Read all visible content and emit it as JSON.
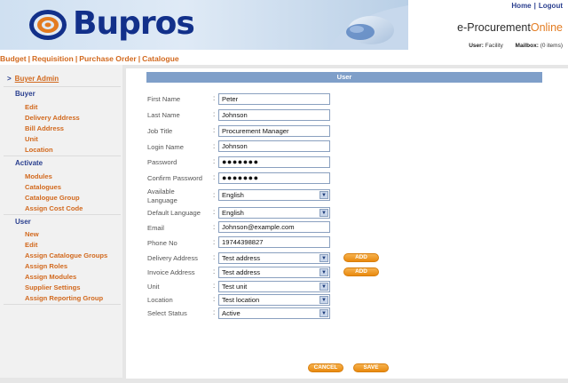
{
  "header": {
    "logo_text": "Bupros",
    "top_links": [
      "Home",
      "Logout"
    ],
    "brand": "e-Procurement",
    "brand_suffix": "Online",
    "user_label": "User:",
    "user_value": "Facility",
    "mailbox_label": "Mailbox:",
    "mailbox_value": "(0 items)"
  },
  "mainnav": [
    "Budget",
    "Requisition",
    "Purchase Order",
    "Catalogue"
  ],
  "sidebar": {
    "admin_link": "Buyer Admin",
    "sections": [
      {
        "heading": "Buyer",
        "items": [
          "Edit",
          "Delivery Address",
          "Bill Address",
          "Unit",
          "Location"
        ]
      },
      {
        "heading": "Activate",
        "items": [
          "Modules",
          "Catalogues",
          "Catalogue Group",
          "Assign Cost Code"
        ]
      },
      {
        "heading": "User",
        "items": [
          "New",
          "Edit",
          "Assign Catalogue Groups",
          "Assign Roles",
          "Assign Modules",
          "Supplier Settings",
          "Assign Reporting Group"
        ]
      }
    ]
  },
  "form": {
    "title": "User",
    "colon": ":",
    "fields": {
      "first_name": {
        "label": "First Name",
        "value": "Peter"
      },
      "last_name": {
        "label": "Last Name",
        "value": "Johnson"
      },
      "job_title": {
        "label": "Job Title",
        "value": "Procurement Manager"
      },
      "login_name": {
        "label": "Login Name",
        "value": "Johnson"
      },
      "password": {
        "label": "Password",
        "value": "●●●●●●●"
      },
      "confirm_password": {
        "label": "Confirm Password",
        "value": "●●●●●●●"
      },
      "available_language": {
        "label_line1": "Available",
        "label_line2": "Language",
        "value": "English"
      },
      "default_language": {
        "label": "Default Language",
        "value": "English"
      },
      "email": {
        "label": "Email",
        "value": "Johnson@example.com"
      },
      "phone": {
        "label": "Phone No",
        "value": "19744398827"
      },
      "delivery_address": {
        "label": "Delivery Address",
        "value": "Test address"
      },
      "invoice_address": {
        "label": "Invoice Address",
        "value": "Test address"
      },
      "unit": {
        "label": "Unit",
        "value": "Test unit"
      },
      "location": {
        "label": "Location",
        "value": "Test location"
      },
      "status": {
        "label": "Select Status",
        "value": "Active"
      }
    },
    "add_label": "ADD",
    "cancel_label": "CANCEL",
    "save_label": "SAVE"
  },
  "colors": {
    "brand_blue": "#12308a",
    "nav_orange": "#d2691e",
    "section_bar": "#7f9fc9",
    "button_orange": "#e98a0e"
  },
  "icons": [
    "bupros-logo-icon",
    "hand-mouse-icon",
    "chevron-down-icon",
    "arrow-right-icon"
  ]
}
